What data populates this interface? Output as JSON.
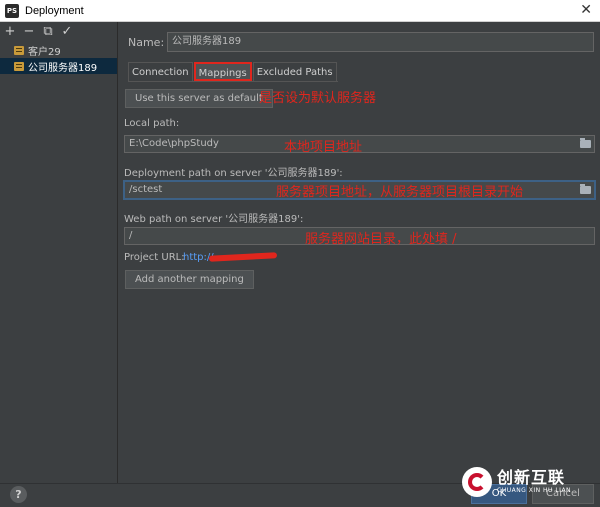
{
  "window": {
    "title": "Deployment",
    "app_icon": "PS"
  },
  "toolbar": {
    "add": "+",
    "remove": "−",
    "copy": "⧉",
    "check": "✓"
  },
  "servers": [
    {
      "label": "客户29",
      "selected": false
    },
    {
      "label": "公司服务器189",
      "selected": true
    }
  ],
  "form": {
    "name_label": "Name:",
    "name_value": "公司服务器189",
    "tabs": [
      "Connection",
      "Mappings",
      "Excluded Paths"
    ],
    "default_button": "Use this server as default",
    "local_path_label": "Local path:",
    "local_path_value": "E:\\Code\\phpStudy",
    "deploy_path_label": "Deployment path on server '公司服务器189':",
    "deploy_path_value": "/sctest",
    "web_path_label": "Web path on server '公司服务器189':",
    "web_path_value": "/",
    "project_url_label": "Project URL:",
    "project_url_value": "http://",
    "add_mapping_button": "Add another mapping"
  },
  "annotations": {
    "default": "是否设为默认服务器",
    "local": "本地项目地址",
    "deploy": "服务器项目地址，从服务器项目根目录开始",
    "web": "服务器网站目录，此处填 /"
  },
  "footer": {
    "help": "?",
    "ok": "OK",
    "cancel": "Cancel"
  },
  "watermark": {
    "cn": "创新互联",
    "en": "CHUANG XIN HU LIAN"
  },
  "colors": {
    "accent": "#e0261d",
    "selected": "#0d293e",
    "link": "#589df6"
  }
}
